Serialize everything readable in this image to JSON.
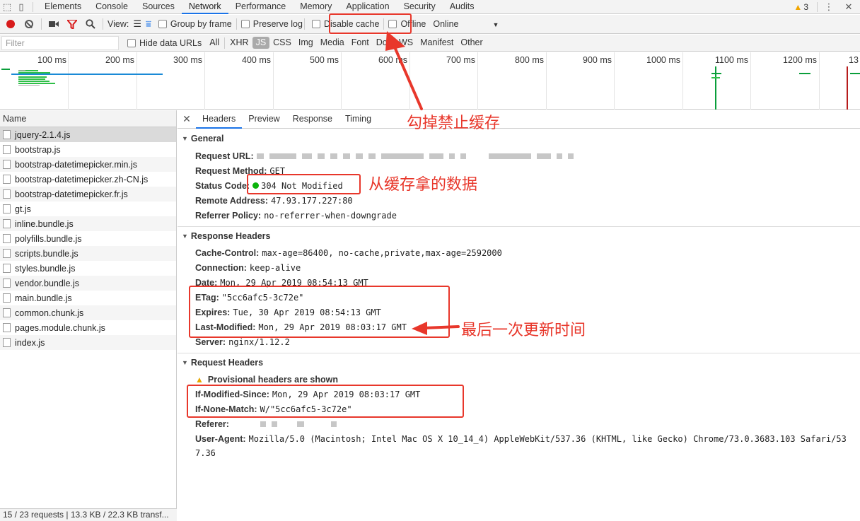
{
  "devtools_tabs": [
    "Elements",
    "Console",
    "Sources",
    "Network",
    "Performance",
    "Memory",
    "Application",
    "Security",
    "Audits"
  ],
  "active_tab": "Network",
  "warnings_count": "3",
  "toolbar": {
    "view_label": "View:",
    "group_by_frame": "Group by frame",
    "preserve_log": "Preserve log",
    "disable_cache": "Disable cache",
    "offline": "Offline",
    "throttle": "Online"
  },
  "filter": {
    "placeholder": "Filter",
    "hide_data_urls": "Hide data URLs",
    "types": [
      "All",
      "XHR",
      "JS",
      "CSS",
      "Img",
      "Media",
      "Font",
      "Doc",
      "WS",
      "Manifest",
      "Other"
    ],
    "selected_type": "JS"
  },
  "timeline": {
    "ticks": [
      "100 ms",
      "200 ms",
      "300 ms",
      "400 ms",
      "500 ms",
      "600 ms",
      "700 ms",
      "800 ms",
      "900 ms",
      "1000 ms",
      "1100 ms",
      "1200 ms",
      "13"
    ]
  },
  "requests": {
    "header": "Name",
    "items": [
      "jquery-2.1.4.js",
      "bootstrap.js",
      "bootstrap-datetimepicker.min.js",
      "bootstrap-datetimepicker.zh-CN.js",
      "bootstrap-datetimepicker.fr.js",
      "gt.js",
      "inline.bundle.js",
      "polyfills.bundle.js",
      "scripts.bundle.js",
      "styles.bundle.js",
      "vendor.bundle.js",
      "main.bundle.js",
      "common.chunk.js",
      "pages.module.chunk.js",
      "index.js"
    ],
    "status": "15 / 23 requests | 13.3 KB / 22.3 KB transf..."
  },
  "detail_tabs": [
    "Headers",
    "Preview",
    "Response",
    "Timing"
  ],
  "general": {
    "title": "General",
    "request_url_key": "Request URL:",
    "request_method_key": "Request Method:",
    "request_method": "GET",
    "status_code_key": "Status Code:",
    "status_code": "304 Not Modified",
    "remote_address_key": "Remote Address:",
    "remote_address": "47.93.177.227:80",
    "referrer_policy_key": "Referrer Policy:",
    "referrer_policy": "no-referrer-when-downgrade"
  },
  "response_headers": {
    "title": "Response Headers",
    "rows": [
      {
        "key": "Cache-Control:",
        "value": "max-age=86400, no-cache,private,max-age=2592000"
      },
      {
        "key": "Connection:",
        "value": "keep-alive"
      },
      {
        "key": "Date:",
        "value": "Mon, 29 Apr 2019 08:54:13 GMT"
      },
      {
        "key": "ETag:",
        "value": "\"5cc6afc5-3c72e\""
      },
      {
        "key": "Expires:",
        "value": "Tue, 30 Apr 2019 08:54:13 GMT"
      },
      {
        "key": "Last-Modified:",
        "value": "Mon, 29 Apr 2019 08:03:17 GMT"
      },
      {
        "key": "Server:",
        "value": "nginx/1.12.2"
      }
    ]
  },
  "request_headers": {
    "title": "Request Headers",
    "provisional": "Provisional headers are shown",
    "if_modified_since_key": "If-Modified-Since:",
    "if_modified_since": "Mon, 29 Apr 2019 08:03:17 GMT",
    "if_none_match_key": "If-None-Match:",
    "if_none_match": "W/\"5cc6afc5-3c72e\"",
    "referer_key": "Referer:",
    "user_agent_key": "User-Agent:",
    "user_agent_1": "Mozilla/5.0 (Macintosh; Intel Mac OS X 10_14_4) AppleWebKit/537.36 (KHTML, like Gecko) Chrome/73.0.3683.103 Safari/53",
    "user_agent_2": "7.36"
  },
  "annotations": {
    "disable_cache_note": "勾掉禁止缓存",
    "from_cache_note": "从缓存拿的数据",
    "last_update_note": "最后一次更新时间"
  },
  "colors": {
    "annotation_red": "#e8372b",
    "active_blue": "#1a73e8",
    "status_green": "#0bb30b"
  }
}
